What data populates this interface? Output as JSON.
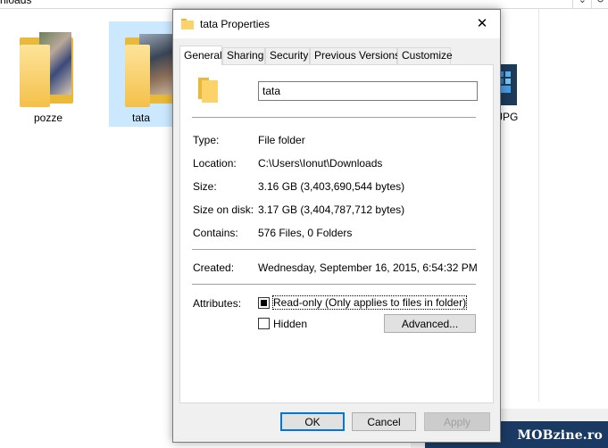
{
  "explorer": {
    "address_text": "nloads",
    "files": [
      {
        "label": "pozze"
      },
      {
        "label": "tata"
      },
      {
        "label": "JPG"
      }
    ]
  },
  "watermark": "MOBzine.ro",
  "dialog": {
    "title": "tata Properties",
    "close_glyph": "✕",
    "tabs": [
      {
        "label": "General"
      },
      {
        "label": "Sharing"
      },
      {
        "label": "Security"
      },
      {
        "label": "Previous Versions"
      },
      {
        "label": "Customize"
      }
    ],
    "name_value": "tata",
    "rows": {
      "type": {
        "label": "Type:",
        "value": "File folder"
      },
      "location": {
        "label": "Location:",
        "value": "C:\\Users\\Ionut\\Downloads"
      },
      "size": {
        "label": "Size:",
        "value": "3.16 GB (3,403,690,544 bytes)"
      },
      "size_on_disk": {
        "label": "Size on disk:",
        "value": "3.17 GB (3,404,787,712 bytes)"
      },
      "contains": {
        "label": "Contains:",
        "value": "576 Files, 0 Folders"
      },
      "created": {
        "label": "Created:",
        "value": "Wednesday, September 16, 2015, 6:54:32 PM"
      }
    },
    "attributes_label": "Attributes:",
    "readonly_label": "Read-only (Only applies to files in folder)",
    "hidden_label": "Hidden",
    "advanced_label": "Advanced...",
    "ok_label": "OK",
    "cancel_label": "Cancel",
    "apply_label": "Apply"
  },
  "colors": {
    "accent": "#0078d7",
    "folder_yellow": "#fcd36b",
    "selection": "#cce8ff"
  }
}
